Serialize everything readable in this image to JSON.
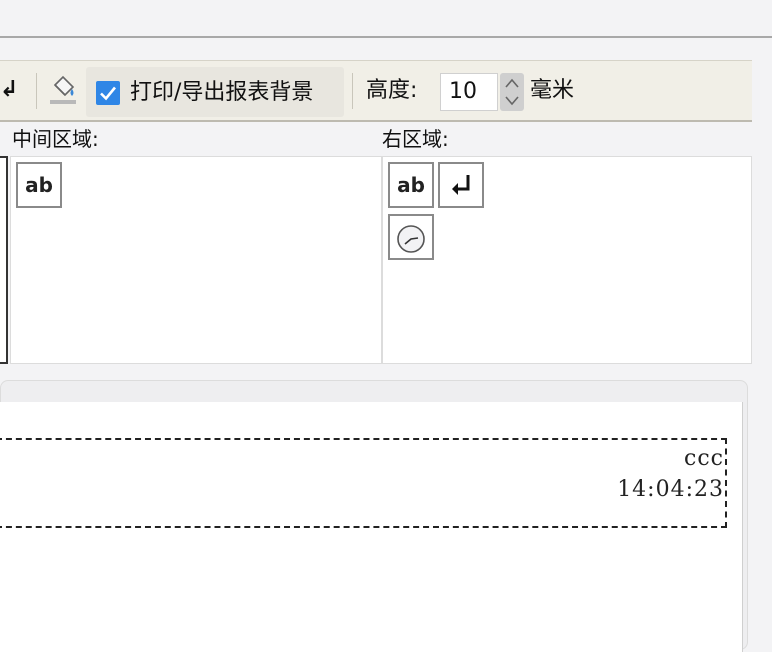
{
  "toolbar": {
    "print_bg_label": "打印/导出报表背景",
    "print_bg_checked": true,
    "height_label": "高度:",
    "height_value": "10",
    "height_unit": "毫米"
  },
  "regions": {
    "middle_label": "中间区域:",
    "right_label": "右区域:",
    "text_tile": "ab"
  },
  "preview": {
    "line1": "ccc",
    "line2": "14:04:23"
  },
  "colors": {
    "accent": "#2f86e6",
    "toolbar_bg": "#f1efe7"
  }
}
